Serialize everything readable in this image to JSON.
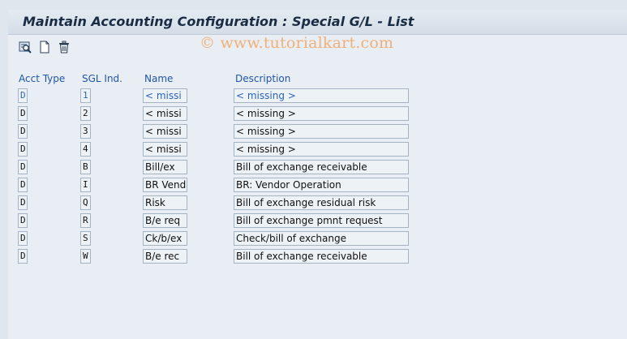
{
  "title": "Maintain Accounting Configuration : Special G/L - List",
  "watermark": "© www.tutorialkart.com",
  "toolbar": [
    {
      "name": "details-icon"
    },
    {
      "name": "new-entry-icon"
    },
    {
      "name": "delete-icon"
    }
  ],
  "columns": {
    "acct_type": "Acct Type",
    "sgl_ind": "SGL Ind.",
    "name": "Name",
    "description": "Description"
  },
  "rows": [
    {
      "acct": "D",
      "sgl": "1",
      "name": "< missi",
      "desc": "< missing >"
    },
    {
      "acct": "D",
      "sgl": "2",
      "name": "< missi",
      "desc": "< missing >"
    },
    {
      "acct": "D",
      "sgl": "3",
      "name": "< missi",
      "desc": "< missing >"
    },
    {
      "acct": "D",
      "sgl": "4",
      "name": "< missi",
      "desc": "< missing >"
    },
    {
      "acct": "D",
      "sgl": "B",
      "name": "Bill/ex",
      "desc": "Bill of exchange receivable"
    },
    {
      "acct": "D",
      "sgl": "I",
      "name": "BR Vend",
      "desc": "BR: Vendor Operation"
    },
    {
      "acct": "D",
      "sgl": "Q",
      "name": "Risk",
      "desc": "Bill of exchange residual risk"
    },
    {
      "acct": "D",
      "sgl": "R",
      "name": "B/e req",
      "desc": "Bill of exchange pmnt request"
    },
    {
      "acct": "D",
      "sgl": "S",
      "name": "Ck/b/ex",
      "desc": "Check/bill of exchange"
    },
    {
      "acct": "D",
      "sgl": "W",
      "name": "B/e rec",
      "desc": "Bill of exchange receivable"
    }
  ],
  "colors": {
    "header_text": "#2255a8",
    "selected_text": "#2a63b8",
    "background": "#e8eef4"
  }
}
